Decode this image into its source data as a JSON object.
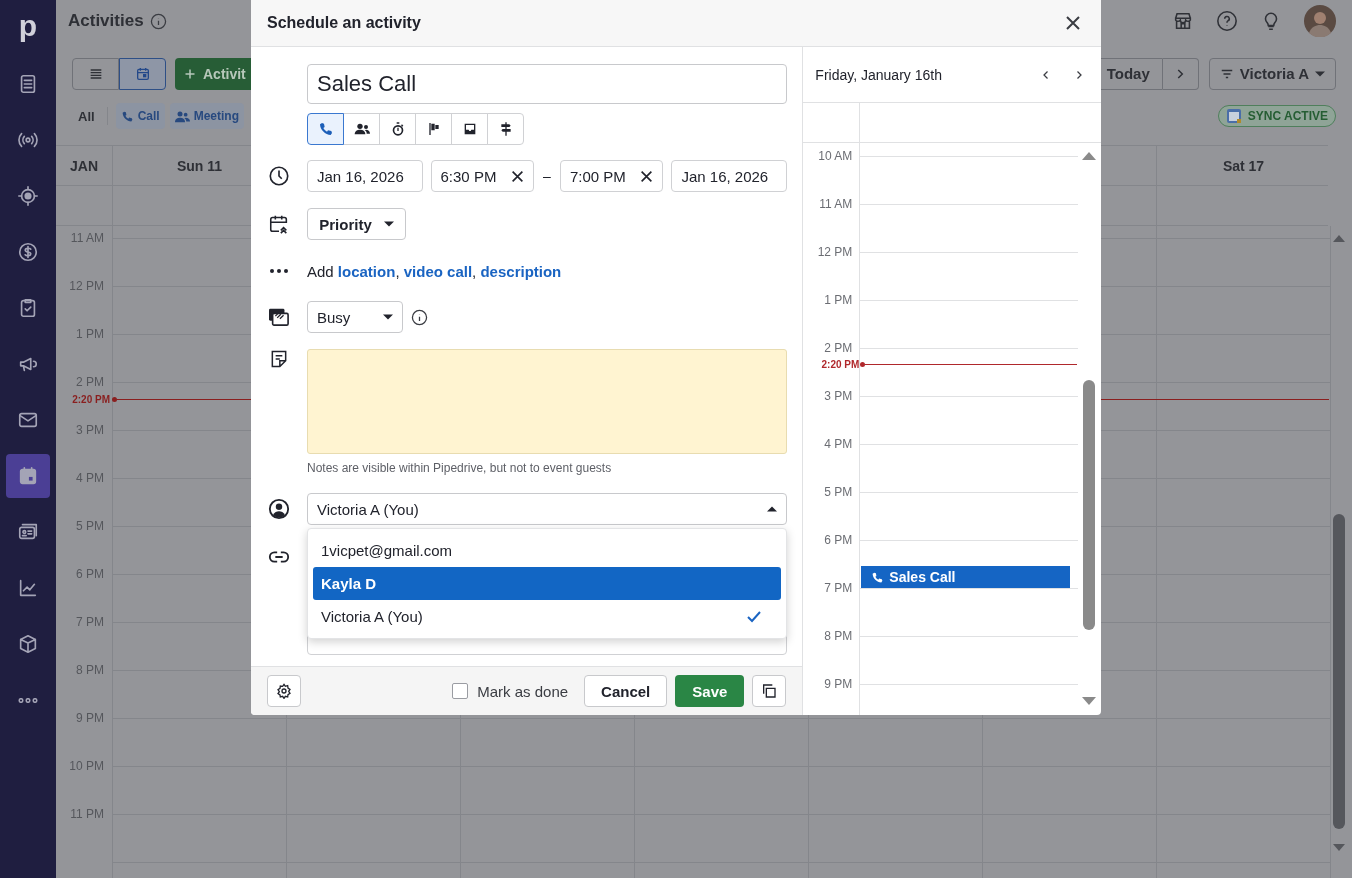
{
  "sidebar": {
    "logo": "p",
    "items": [
      {
        "selected": false
      },
      {
        "selected": false
      },
      {
        "selected": false
      },
      {
        "selected": false
      },
      {
        "selected": false
      },
      {
        "selected": false
      },
      {
        "selected": false
      },
      {
        "selected": true
      },
      {
        "selected": false
      },
      {
        "selected": false
      },
      {
        "selected": false
      },
      {
        "selected": false
      }
    ]
  },
  "header": {
    "title": "Activities"
  },
  "toolbar": {
    "views": [
      {
        "selected": false
      },
      {
        "selected": true
      }
    ],
    "add_button": "Activit",
    "today_button": "Today",
    "owner_filter": "Victoria A"
  },
  "filters": [
    {
      "label": "All",
      "kind": "plain"
    },
    {
      "label": "Call",
      "kind": "call"
    },
    {
      "label": "Meeting",
      "kind": "meeting"
    }
  ],
  "sync_badge": "SYNC ACTIVE",
  "calendar": {
    "month": "JAN",
    "days": [
      "Sun 11",
      "Sat 17"
    ],
    "hours": [
      "11 AM",
      "12 PM",
      "1 PM",
      "2 PM",
      "3 PM",
      "4 PM",
      "5 PM",
      "6 PM",
      "7 PM",
      "8 PM",
      "9 PM",
      "10 PM",
      "11 PM"
    ],
    "now_label": "2:20 PM"
  },
  "modal": {
    "title": "Schedule an activity",
    "subject": "Sales Call",
    "activity_types": [
      {
        "selected": true
      },
      {
        "selected": false
      },
      {
        "selected": false
      },
      {
        "selected": false
      },
      {
        "selected": false
      },
      {
        "selected": false
      }
    ],
    "start_date": "Jan 16, 2026",
    "start_time": "6:30 PM",
    "range_separator": "–",
    "end_time": "7:00 PM",
    "end_date": "Jan 16, 2026",
    "priority": "Priority",
    "add_details": {
      "prefix": "Add",
      "separator": ",",
      "links": [
        "location",
        "video call",
        "description"
      ]
    },
    "availability": "Busy",
    "notes_hint": "Notes are visible within Pipedrive, but not to event guests",
    "owner": {
      "value": "Victoria A (You)",
      "expanded": true,
      "options": [
        {
          "label": "1vicpet@gmail.com",
          "highlighted": false,
          "checked": false
        },
        {
          "label": "Kayla D",
          "highlighted": true,
          "checked": false
        },
        {
          "label": "Victoria A (You)",
          "highlighted": false,
          "checked": true
        }
      ]
    },
    "mark_done": {
      "label": "Mark as done",
      "checked": false
    },
    "cancel": "Cancel",
    "save": "Save"
  },
  "day_panel": {
    "title": "Friday, January 16th",
    "hours": [
      "10 AM",
      "11 AM",
      "12 PM",
      "1 PM",
      "2 PM",
      "3 PM",
      "4 PM",
      "5 PM",
      "6 PM",
      "7 PM",
      "8 PM",
      "9 PM"
    ],
    "now_label": "2:20 PM",
    "event": {
      "title": "Sales Call"
    }
  }
}
